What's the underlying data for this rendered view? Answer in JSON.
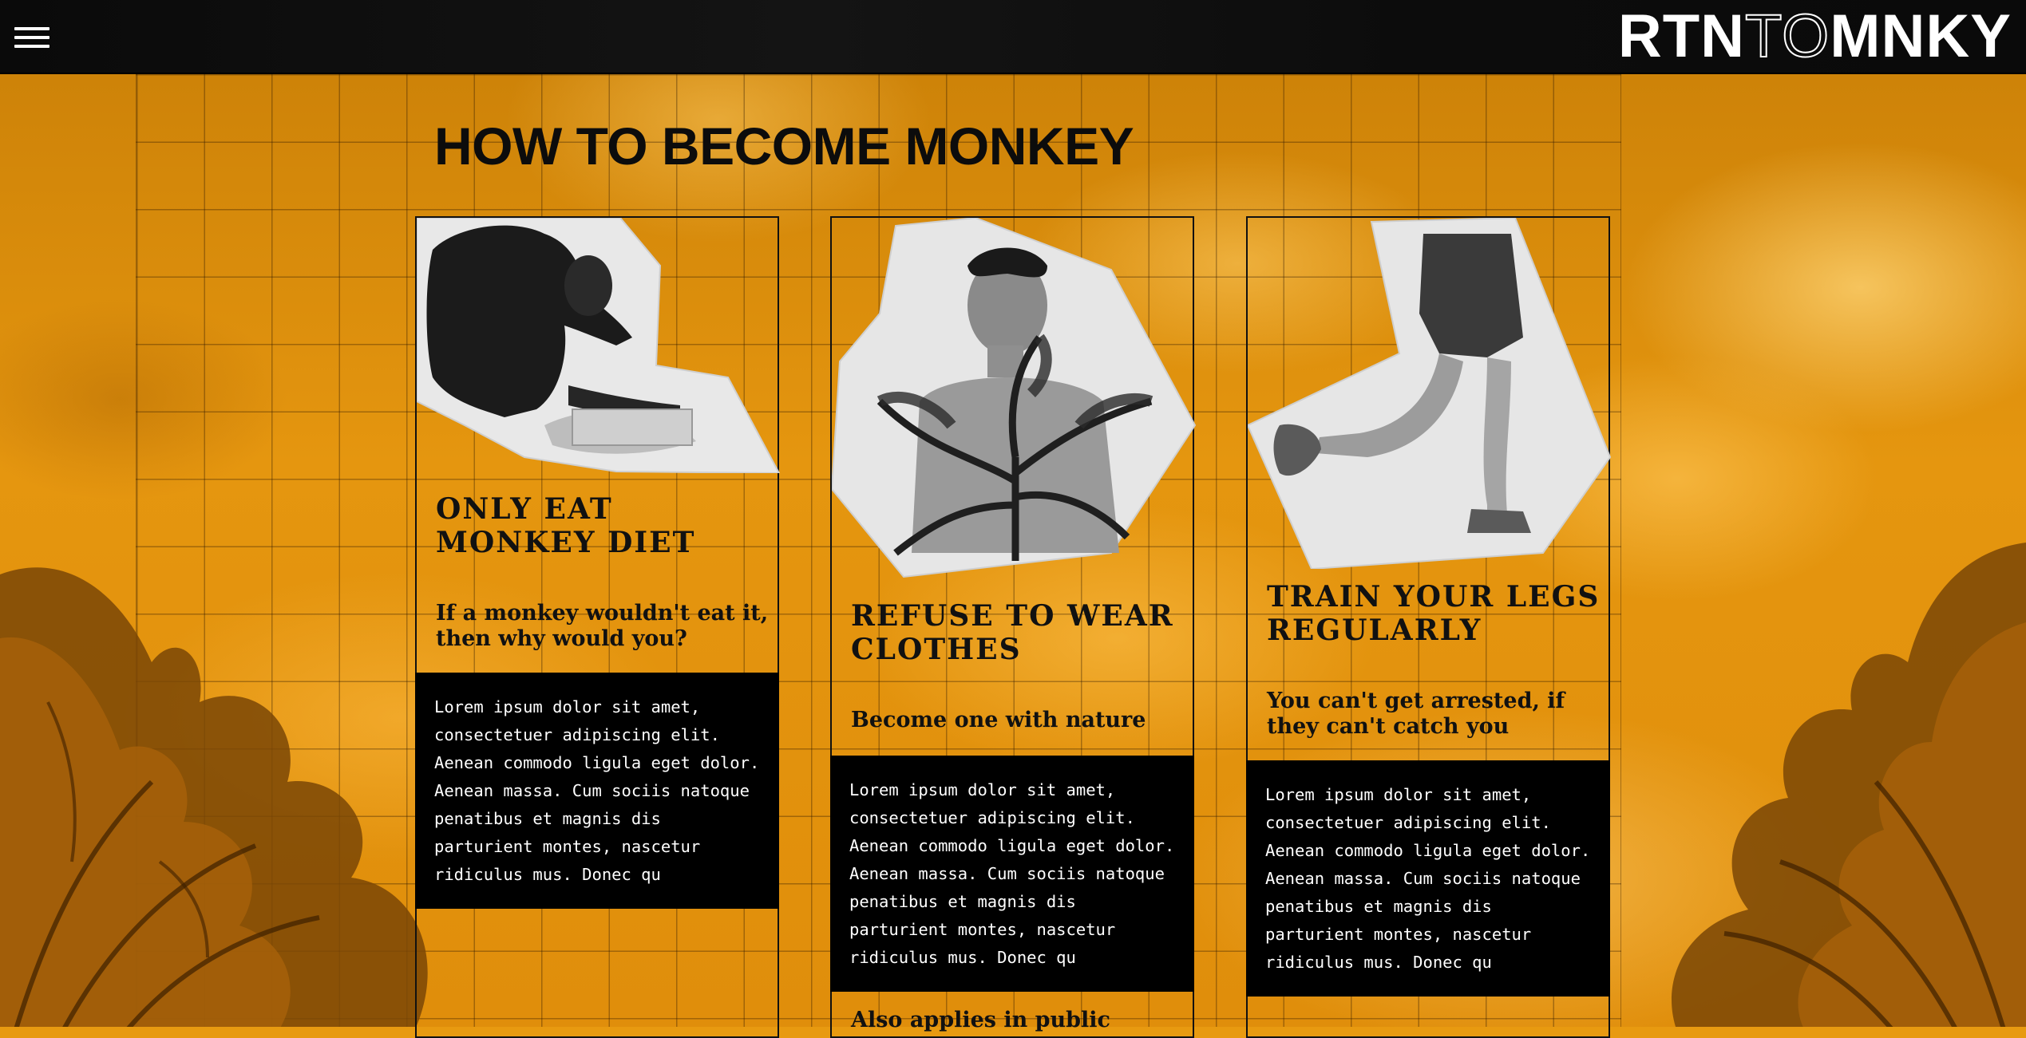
{
  "header": {
    "menu_icon": "hamburger-menu-icon",
    "logo_part1": "RTN",
    "logo_part2": "TO",
    "logo_part3": "MNKY"
  },
  "page": {
    "title": "HOW TO BECOME MONKEY"
  },
  "cards": [
    {
      "heading_line1": "ONLY EAT",
      "heading_line2": "MONKEY DIET",
      "subtitle": "If a monkey wouldn't eat it, then why would you?",
      "body": "Lorem ipsum dolor sit amet, consectetuer adipiscing elit. Aenean commodo ligula eget dolor. Aenean massa. Cum sociis natoque penatibus et magnis dis parturient montes, nascetur ridiculus mus. Donec qu",
      "image": "monkey-photo"
    },
    {
      "heading_line1": "REFUSE TO WEAR",
      "heading_line2": "CLOTHES",
      "subtitle": "Become one with nature",
      "body": "Lorem ipsum dolor sit amet, consectetuer adipiscing elit. Aenean commodo ligula eget dolor. Aenean massa. Cum sociis natoque penatibus et magnis dis parturient montes, nascetur ridiculus mus. Donec qu",
      "extra": "Also applies in public",
      "image": "man-with-plant-photo"
    },
    {
      "heading_line1": "TRAIN YOUR LEGS",
      "heading_line2": "REGULARLY",
      "subtitle": "You can't get arrested, if they can't catch you",
      "body": "Lorem ipsum dolor sit amet, consectetuer adipiscing elit. Aenean commodo ligula eget dolor. Aenean massa. Cum sociis natoque penatibus et magnis dis parturient montes, nascetur ridiculus mus. Donec qu",
      "image": "running-legs-photo"
    }
  ],
  "colors": {
    "background": "#e89a10",
    "ink": "#111111",
    "header": "#0a0a0a",
    "paper": "#e6e6e6"
  }
}
